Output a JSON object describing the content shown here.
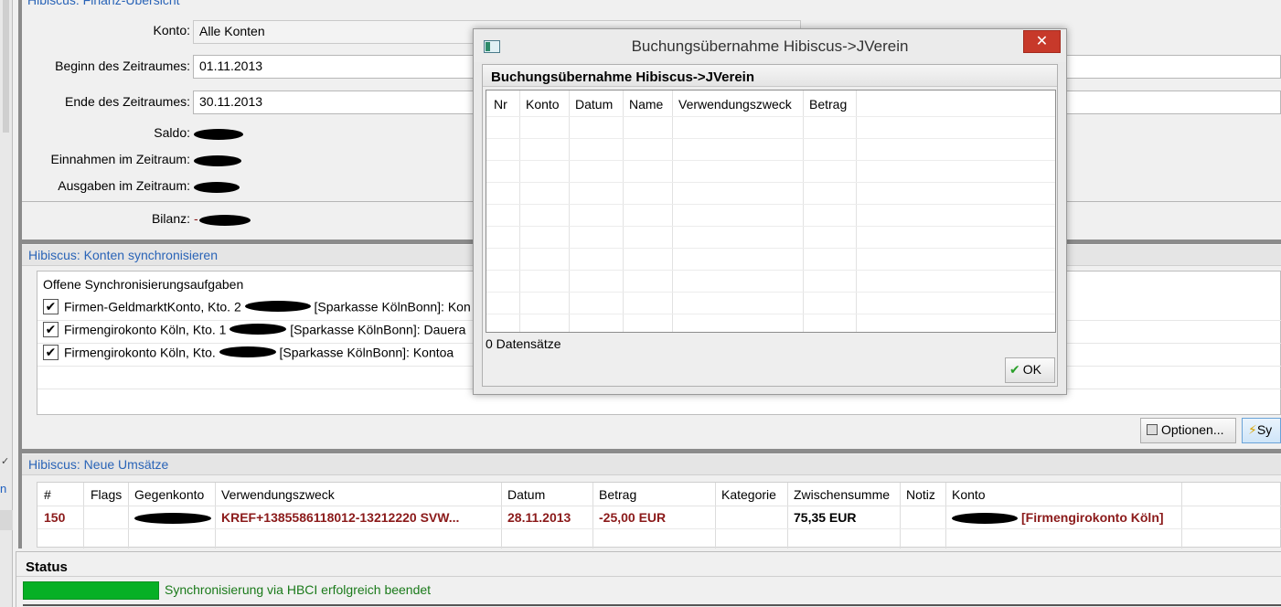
{
  "colors": {
    "panel_title": "#2a64b7",
    "highlight_red": "#8b1a1a",
    "success_green": "#1a7a1a",
    "progress": "#06b025",
    "close_button": "#c7392a"
  },
  "overview": {
    "title": "Hibiscus: Finanz-Übersicht",
    "konto_label": "Konto:",
    "konto_value": "Alle Konten",
    "beginn_label": "Beginn des Zeitraumes:",
    "beginn_value": "01.11.2013",
    "ende_label": "Ende des Zeitraumes:",
    "ende_value": "30.11.2013",
    "saldo_label": "Saldo:",
    "einnahmen_label": "Einnahmen im Zeitraum:",
    "ausgaben_label": "Ausgaben im Zeitraum:",
    "bilanz_label": "Bilanz:",
    "bilanz_prefix": "-"
  },
  "sync": {
    "title": "Hibiscus: Konten synchronisieren",
    "group_title": "Offene Synchronisierungsaufgaben",
    "tasks": [
      {
        "prefix": "Firmen-GeldmarktKonto, Kto. 2",
        "suffix": "[Sparkasse KölnBonn]: Kon",
        "checked": true
      },
      {
        "prefix": "Firmengirokonto Köln, Kto. 1",
        "suffix": "[Sparkasse KölnBonn]: Dauera",
        "checked": true
      },
      {
        "prefix": "Firmengirokonto Köln, Kto.",
        "suffix": "[Sparkasse KölnBonn]: Kontoa",
        "checked": true
      }
    ],
    "options_button": "Optionen...",
    "sync_button": "Sy"
  },
  "umsaetze": {
    "title": "Hibiscus: Neue Umsätze",
    "columns": [
      "#",
      "Flags",
      "Gegenkonto",
      "Verwendungszweck",
      "Datum",
      "Betrag",
      "Kategorie",
      "Zwischensumme",
      "Notiz",
      "Konto"
    ],
    "row": {
      "nr": "150",
      "flags": "",
      "verwendungszweck": "KREF+1385586118012-13212220 SVW...",
      "datum": "28.11.2013",
      "betrag": "-25,00 EUR",
      "kategorie": "",
      "zwischensumme": "75,35 EUR",
      "notiz": "",
      "konto": "[Firmengirokonto Köln]"
    }
  },
  "status": {
    "title": "Status",
    "progress": 1.0,
    "message": "Synchronisierung via HBCI erfolgreich beendet"
  },
  "dialog": {
    "title": "Buchungsübernahme Hibiscus->JVerein",
    "group_title": "Buchungsübernahme Hibiscus->JVerein",
    "close_glyph": "✕",
    "columns": [
      "Nr",
      "Konto",
      "Datum",
      "Name",
      "Verwendungszweck",
      "Betrag"
    ],
    "count": "0 Datensätze",
    "ok_button": "OK"
  },
  "left_strip": {
    "link_text": "n",
    "tick": "✓"
  }
}
